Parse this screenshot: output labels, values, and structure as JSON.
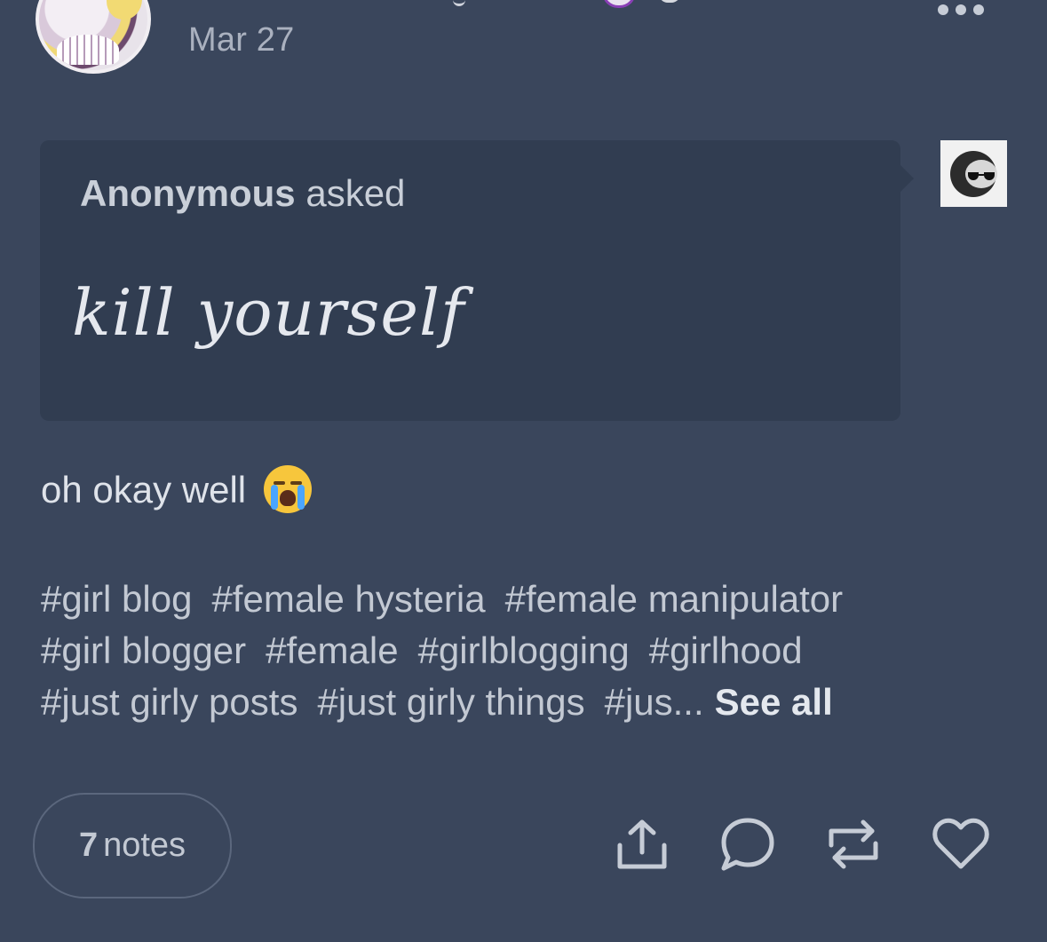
{
  "post": {
    "date": "Mar 27",
    "ask": {
      "asker_name": "Anonymous",
      "asker_verb": "asked",
      "question": "kill yourself"
    },
    "reply": "oh okay well",
    "tags": [
      "#girl blog",
      "#female hysteria",
      "#female manipulator",
      "#girl blogger",
      "#female",
      "#girlblogging",
      "#girlhood",
      "#just girly posts",
      "#just girly things",
      "#jus..."
    ],
    "see_all": "See all",
    "notes_count": "7",
    "notes_label": "notes"
  },
  "icons": [
    "more-icon",
    "share-icon",
    "reply-icon",
    "reblog-icon",
    "like-icon",
    "loudly-crying-emoji"
  ],
  "colors": {
    "background": "#3a465c",
    "ask_box": "#313d51",
    "text": "#c3c9d3"
  }
}
